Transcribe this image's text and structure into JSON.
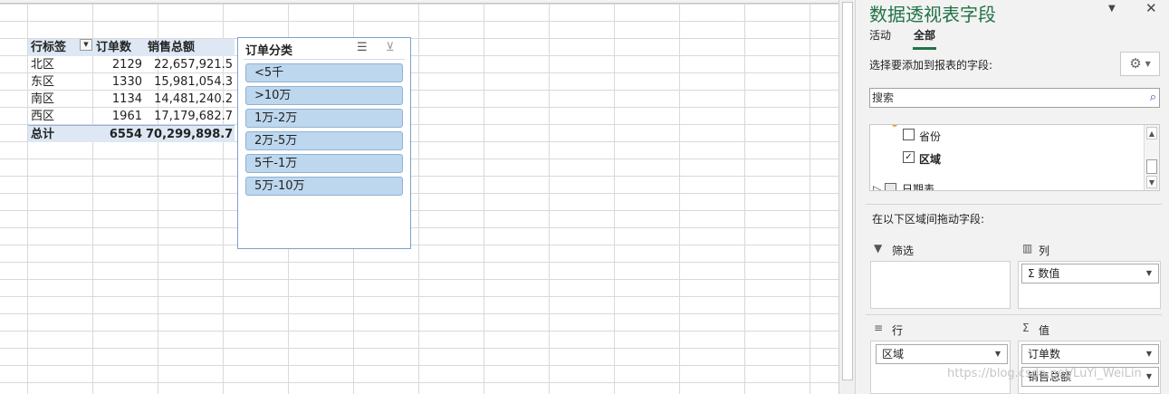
{
  "pivot_table": {
    "headers": {
      "row_label": "行标签",
      "order_count": "订单数",
      "sales_total": "销售总额"
    },
    "rows": [
      {
        "region": "北区",
        "orders": "2129",
        "sales": "22,657,921.5"
      },
      {
        "region": "东区",
        "orders": "1330",
        "sales": "15,981,054.3"
      },
      {
        "region": "南区",
        "orders": "1134",
        "sales": "14,481,240.2"
      },
      {
        "region": "西区",
        "orders": "1961",
        "sales": "17,179,682.7"
      }
    ],
    "total": {
      "label": "总计",
      "orders": "6554",
      "sales": "70,299,898.7"
    }
  },
  "slicer": {
    "title": "订单分类",
    "items": [
      "<5千",
      ">10万",
      "1万-2万",
      "2万-5万",
      "5千-1万",
      "5万-10万"
    ]
  },
  "pane": {
    "title": "数据透视表字段",
    "tabs": [
      "活动",
      "全部"
    ],
    "active_tab": "全部",
    "choose_fields_label": "选择要添加到报表的字段:",
    "search_placeholder": "搜索",
    "fields": [
      {
        "name": "省份",
        "checked": false
      },
      {
        "name": "区域",
        "checked": true
      }
    ],
    "partial_field": "日期表",
    "drag_instruction": "在以下区域间拖动字段:",
    "areas": {
      "filter": {
        "label": "筛选",
        "chips": []
      },
      "columns": {
        "label": "列",
        "chips": [
          "Σ 数值"
        ]
      },
      "rows": {
        "label": "行",
        "chips": [
          "区域"
        ]
      },
      "values": {
        "label": "值",
        "chips": [
          "订单数",
          "销售总额"
        ]
      }
    }
  },
  "watermark": "https://blog.csdn.net/LuYi_WeiLin",
  "colors": {
    "accent_green": "#217346",
    "slicer_item": "#bdd7ee",
    "header_fill": "#dde8f4"
  }
}
